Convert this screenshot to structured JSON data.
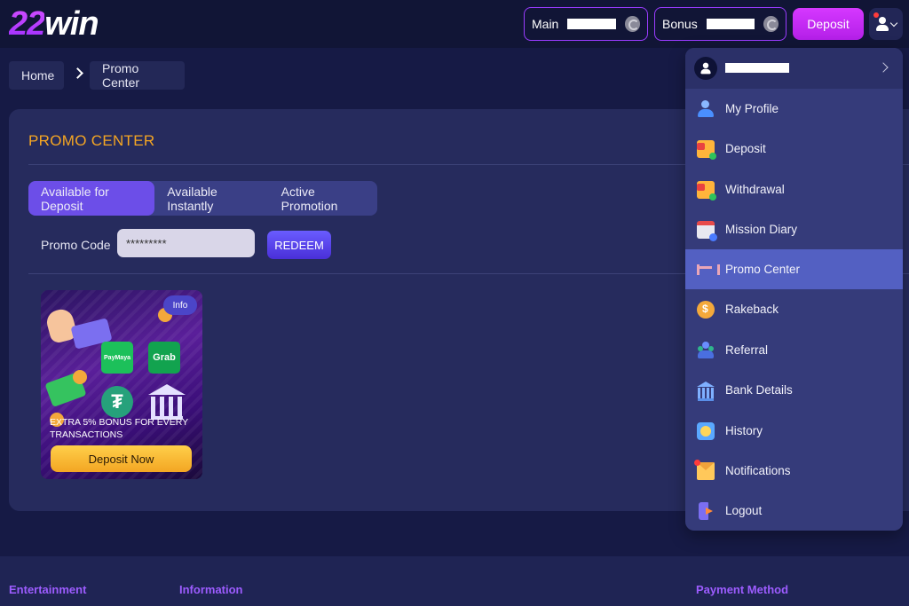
{
  "header": {
    "logo_num": "22",
    "logo_word": "win",
    "balances": [
      {
        "label": "Main"
      },
      {
        "label": "Bonus"
      }
    ],
    "deposit_label": "Deposit"
  },
  "breadcrumb": {
    "home": "Home",
    "current": "Promo Center"
  },
  "main": {
    "title": "PROMO CENTER",
    "tabs": [
      {
        "label": "Available for Deposit",
        "active": true
      },
      {
        "label": "Available Instantly",
        "active": false
      },
      {
        "label": "Active Promotion",
        "active": false
      }
    ],
    "promo_code_label": "Promo Code",
    "promo_code_value": "*********",
    "redeem_label": "REDEEM",
    "card": {
      "info": "Info",
      "paymaya": "PayMaya",
      "grab": "Grab",
      "tether": "₮",
      "text": "EXTRA 5% BONUS FOR EVERY TRANSACTIONS",
      "button": "Deposit Now"
    }
  },
  "footer": {
    "headings": [
      "Entertainment",
      "Information",
      "Payment Method"
    ]
  },
  "dropdown": {
    "items": [
      {
        "label": "My Profile",
        "icon": "profile-icon"
      },
      {
        "label": "Deposit",
        "icon": "deposit-wallet-icon"
      },
      {
        "label": "Withdrawal",
        "icon": "withdrawal-wallet-icon"
      },
      {
        "label": "Mission Diary",
        "icon": "calendar-icon"
      },
      {
        "label": "Promo Center",
        "icon": "promo-icon",
        "active": true
      },
      {
        "label": "Rakeback",
        "icon": "coin-icon"
      },
      {
        "label": "Referral",
        "icon": "referral-icon"
      },
      {
        "label": "Bank Details",
        "icon": "bank-icon"
      },
      {
        "label": "History",
        "icon": "history-icon"
      },
      {
        "label": "Notifications",
        "icon": "notification-icon"
      },
      {
        "label": "Logout",
        "icon": "logout-icon"
      }
    ]
  },
  "colors": {
    "accent": "#b41fe8",
    "title": "#f5a623",
    "active_tab": "#6c4ee8",
    "dropdown_active": "#5360c2"
  }
}
